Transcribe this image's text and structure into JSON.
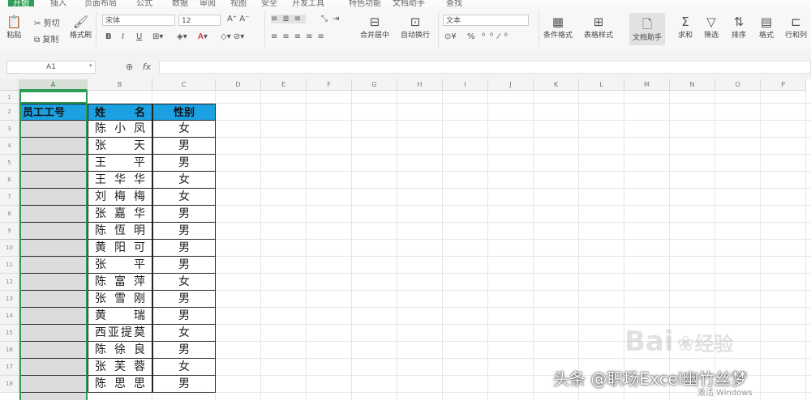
{
  "menubar": {
    "tabs": [
      "开始",
      "插入",
      "页面布局",
      "公式",
      "数据",
      "审阅",
      "视图",
      "安全",
      "开发工具",
      "特色功能",
      "文档助手",
      "查找"
    ],
    "active_tab": "开始"
  },
  "ribbon": {
    "clipboard": {
      "paste": "粘贴",
      "cut": "剪切",
      "copy": "复制",
      "format_painter": "格式刷"
    },
    "font": {
      "name": "宋体",
      "size": "12",
      "bold": "B",
      "italic": "I",
      "underline": "U"
    },
    "alignment": {
      "merge": "合并居中",
      "wrap": "自动换行"
    },
    "number": {
      "format": "文本",
      "currency": "¥",
      "percent": "%"
    },
    "styles": {
      "conditional": "条件格式",
      "table_style": "表格样式"
    },
    "tools": {
      "convert": "文档助手",
      "sum": "求和",
      "filter": "筛选",
      "sort": "排序",
      "format": "格式",
      "rows_cols": "行和列"
    }
  },
  "formula_bar": {
    "cell_ref": "A1",
    "fx": "fx",
    "content": ""
  },
  "columns": [
    "A",
    "B",
    "C",
    "D",
    "E",
    "F",
    "G",
    "H",
    "I",
    "J",
    "K",
    "L",
    "M",
    "N",
    "O",
    "P"
  ],
  "rows": [
    "1",
    "2",
    "3",
    "4",
    "5",
    "6",
    "7",
    "8",
    "9",
    "10",
    "11",
    "12",
    "13",
    "14",
    "15",
    "16",
    "17",
    "18"
  ],
  "table": {
    "headers": {
      "id": "员工工号",
      "name": "姓名",
      "gender": "性别"
    },
    "name_header_chars": [
      "姓",
      "名"
    ],
    "records": [
      {
        "name": [
          "陈",
          "小",
          "凤"
        ],
        "gender": "女"
      },
      {
        "name": [
          "张",
          "天"
        ],
        "gender": "男"
      },
      {
        "name": [
          "王",
          "平"
        ],
        "gender": "男"
      },
      {
        "name": [
          "王",
          "华",
          "华"
        ],
        "gender": "女"
      },
      {
        "name": [
          "刘",
          "梅",
          "梅"
        ],
        "gender": "女"
      },
      {
        "name": [
          "张",
          "嘉",
          "华"
        ],
        "gender": "男"
      },
      {
        "name": [
          "陈",
          "恆",
          "明"
        ],
        "gender": "男"
      },
      {
        "name": [
          "黄",
          "阳",
          "可"
        ],
        "gender": "男"
      },
      {
        "name": [
          "张",
          "平"
        ],
        "gender": "男"
      },
      {
        "name": [
          "陈",
          "富",
          "萍"
        ],
        "gender": "女"
      },
      {
        "name": [
          "张",
          "雪",
          "刚"
        ],
        "gender": "男"
      },
      {
        "name": [
          "黄",
          "瑞"
        ],
        "gender": "男"
      },
      {
        "name": [
          "西",
          "亚",
          "提",
          "莫"
        ],
        "gender": "女"
      },
      {
        "name": [
          "陈",
          "徐",
          "良"
        ],
        "gender": "男"
      },
      {
        "name": [
          "张",
          "芙",
          "蓉"
        ],
        "gender": "女"
      },
      {
        "name": [
          "陈",
          "思",
          "思"
        ],
        "gender": "男"
      }
    ]
  },
  "overlay": {
    "watermark_brand": "Bai",
    "watermark_suffix": "经验",
    "caption": "头条 @职场Excel幽竹丝梦",
    "activate_windows": "激活 Windows"
  }
}
